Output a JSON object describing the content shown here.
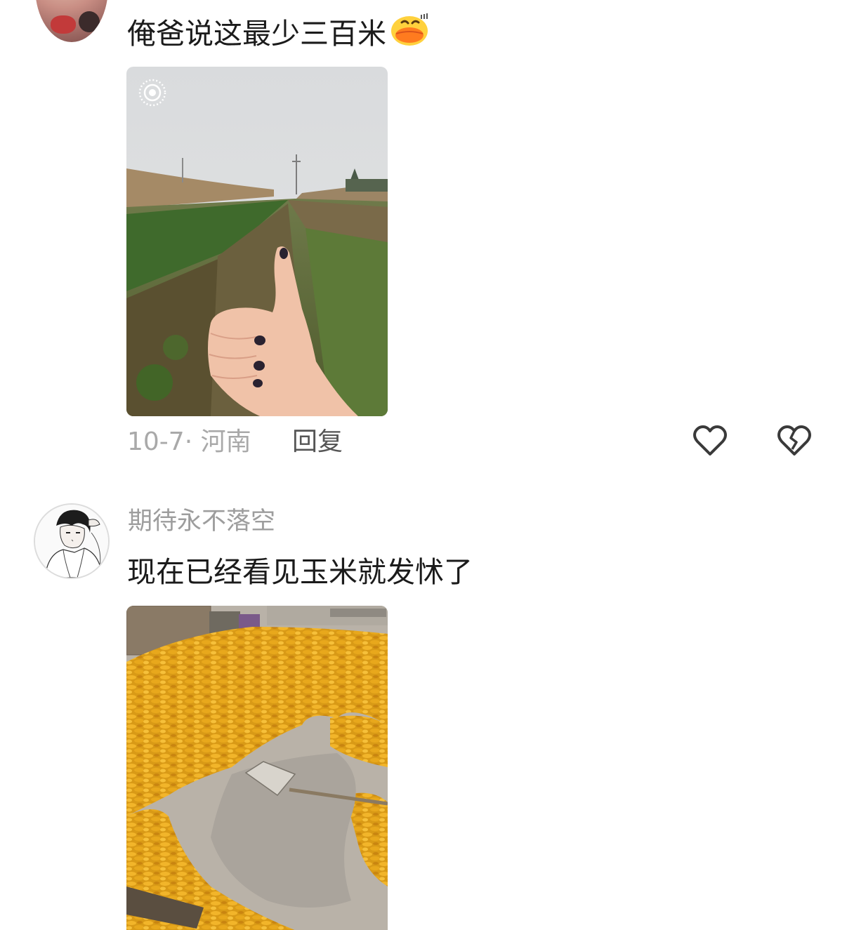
{
  "comments": [
    {
      "text": "俺爸说这最少三百米",
      "emoji": "duck-face-emoji",
      "image": "thumbs-up-over-field-photo",
      "date_location": "10-7· 河南",
      "reply_label": "回复"
    },
    {
      "username": "期待永不落空",
      "text": "现在已经看见玉米就发怵了",
      "image": "drying-corn-photo"
    }
  ],
  "colors": {
    "background": "#ffffff",
    "text_primary": "#1b1b1b",
    "text_meta": "#a9a9a9",
    "username": "#9d9d9d",
    "icon_stroke": "#3a3a3a"
  }
}
